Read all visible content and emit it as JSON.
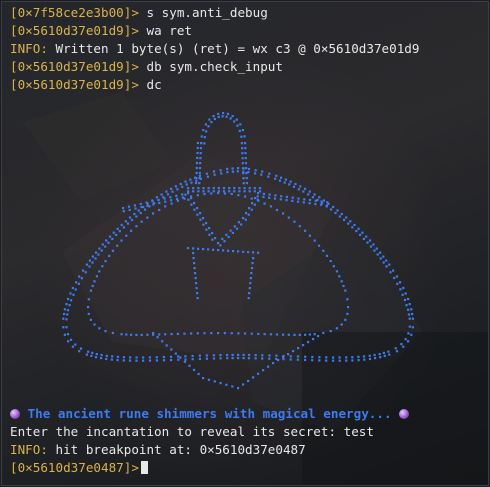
{
  "terminal": {
    "lines": [
      {
        "prompt": "[0×7f58ce2e3b00]>",
        "command": " s sym.anti_debug"
      },
      {
        "prompt": "[0×5610d37e01d9]>",
        "command": " wa ret"
      },
      {
        "info": "INFO:",
        "message": " Written 1 byte(s) (ret) = wx c3 @ 0×5610d37e01d9"
      },
      {
        "prompt": "[0×5610d37e01d9]>",
        "command": " db sym.check_input"
      },
      {
        "prompt": "[0×5610d37e01d9]>",
        "command": " dc"
      }
    ],
    "banner": " The ancient rune shimmers with magical energy... ",
    "incantation_prompt": "Enter the incantation to reveal its secret: test",
    "breakpoint": {
      "info": "INFO:",
      "message": " hit breakpoint at: 0×5610d37e0487"
    },
    "final_prompt": "[0×5610d37e0487]>"
  },
  "colors": {
    "address": "#d9b44a",
    "rune": "#3d7bf0",
    "text": "#e8e8e8"
  },
  "icons": {
    "banner_left": "crystal-ball-icon",
    "banner_right": "crystal-ball-icon"
  }
}
